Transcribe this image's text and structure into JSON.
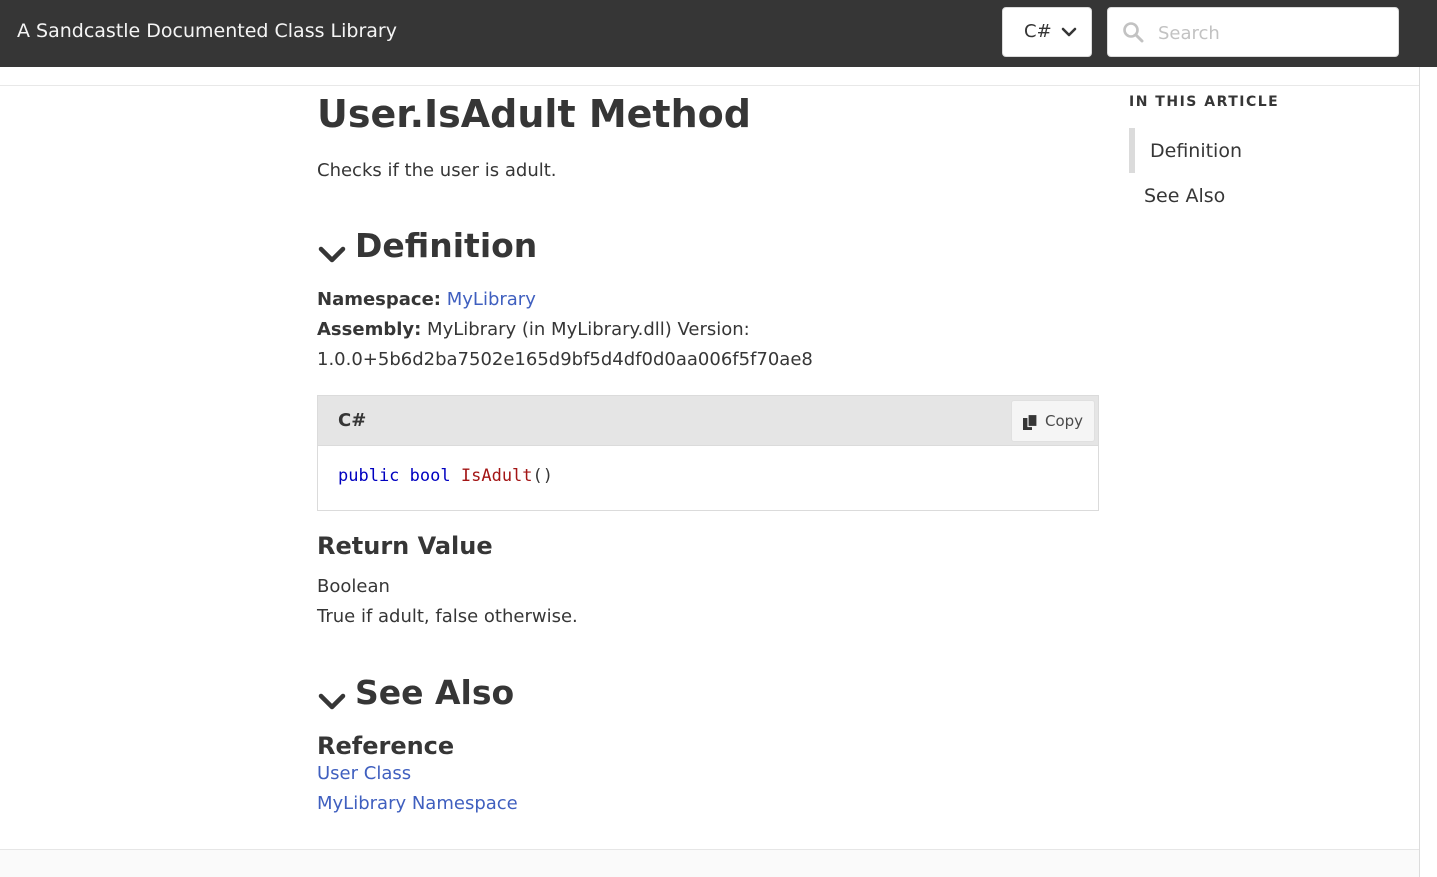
{
  "header": {
    "site_title": "A Sandcastle Documented Class Library",
    "language_selected": "C#",
    "search_placeholder": "Search"
  },
  "article": {
    "title": "User.IsAdult Method",
    "summary": "Checks if the user is adult.",
    "definition": {
      "heading": "Definition",
      "namespace_label": "Namespace:",
      "namespace_link": "MyLibrary",
      "assembly_label": "Assembly:",
      "assembly_text": "MyLibrary (in MyLibrary.dll) Version:",
      "version": "1.0.0+5b6d2ba7502e165d9bf5d4df0d0aa006f5f70ae8"
    },
    "code": {
      "language": "C#",
      "copy_label": "Copy",
      "kw_public": "public",
      "kw_bool": "bool",
      "method_name": "IsAdult",
      "parens": "()"
    },
    "return_value": {
      "heading": "Return Value",
      "type": "Boolean",
      "description": "True if adult, false otherwise."
    },
    "see_also": {
      "heading": "See Also",
      "reference_heading": "Reference",
      "links": [
        "User Class",
        "MyLibrary Namespace"
      ]
    }
  },
  "toc": {
    "title": "IN THIS ARTICLE",
    "items": [
      "Definition",
      "See Also"
    ]
  },
  "colors": {
    "header_bg": "#363636",
    "link": "#3f5fbf",
    "keyword": "#0000c0",
    "identifier": "#a31515"
  }
}
